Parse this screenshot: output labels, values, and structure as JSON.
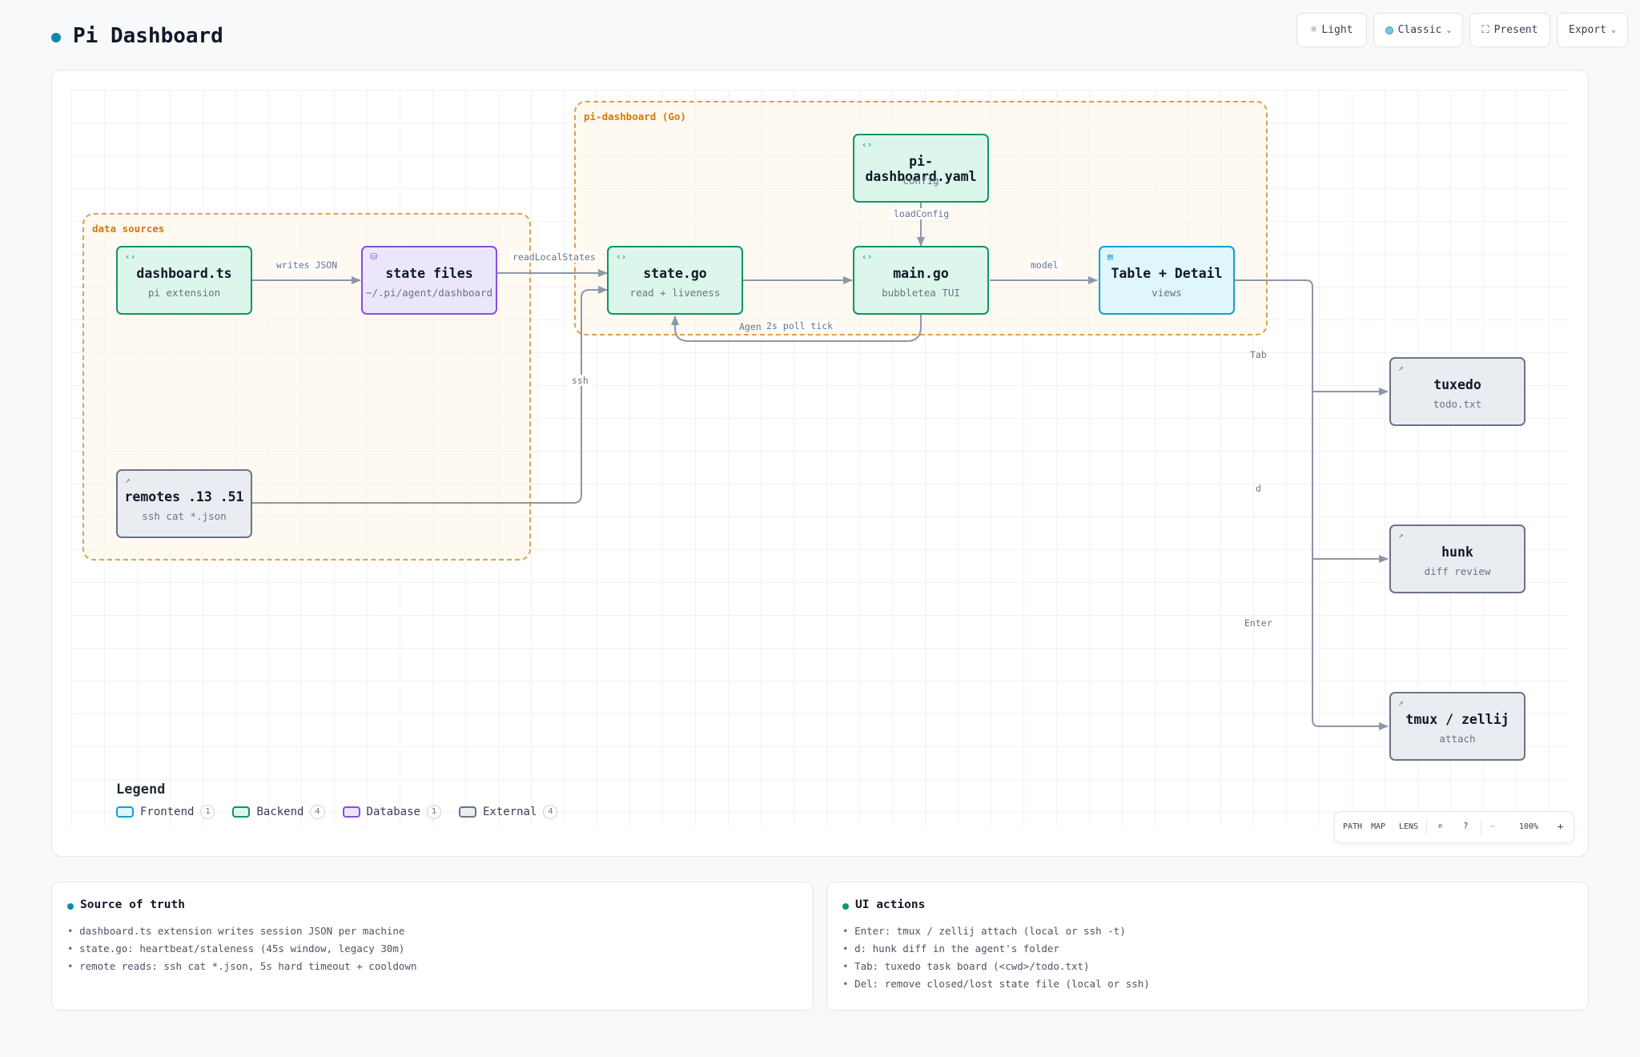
{
  "app": {
    "title": "Pi Dashboard",
    "accent": "#0e8aa8"
  },
  "toolbar": {
    "light": {
      "label": "Light",
      "icon": "sun-icon"
    },
    "classic": {
      "label": "Classic",
      "icon": "theme-dot-icon"
    },
    "present": {
      "label": "Present",
      "icon": "fullscreen-icon"
    },
    "export": {
      "label": "Export",
      "icon": "chevron-down-icon"
    }
  },
  "groups": {
    "data_sources": "data sources",
    "pi_dashboard": "pi-dashboard (Go)"
  },
  "nodes": {
    "dashboard_ts": {
      "title": "dashboard.ts",
      "sub": "pi extension",
      "kind": "Backend"
    },
    "state_files": {
      "title": "state files",
      "sub": "~/.pi/agent/dashboard",
      "kind": "Database"
    },
    "state_go": {
      "title": "state.go",
      "sub": "read + liveness",
      "kind": "Backend"
    },
    "yaml": {
      "title": "pi-dashboard.yaml",
      "sub": "config",
      "kind": "Backend"
    },
    "main_go": {
      "title": "main.go",
      "sub": "bubbletea TUI",
      "kind": "Backend"
    },
    "table": {
      "title": "Table + Detail",
      "sub": "views",
      "kind": "Frontend"
    },
    "remotes": {
      "title": "remotes .13 .51",
      "sub": "ssh cat *.json",
      "kind": "External"
    },
    "tuxedo": {
      "title": "tuxedo",
      "sub": "todo.txt",
      "kind": "External"
    },
    "hunk": {
      "title": "hunk",
      "sub": "diff review",
      "kind": "External"
    },
    "tmux": {
      "title": "tmux / zellij",
      "sub": "attach",
      "kind": "External"
    }
  },
  "edges": {
    "writes_json": "writes JSON",
    "read_local": "readLocalStates",
    "load_config": "loadConfig",
    "model": "model",
    "poll": "2s poll tick",
    "poll_hidden": "Agen",
    "ssh": "ssh",
    "tab": "Tab",
    "d": "d",
    "enter": "Enter"
  },
  "legend": {
    "title": "Legend",
    "items": [
      {
        "label": "Frontend",
        "count": "1",
        "color": "#14a0c8"
      },
      {
        "label": "Backend",
        "count": "4",
        "color": "#12946a"
      },
      {
        "label": "Database",
        "count": "1",
        "color": "#8a4fd8"
      },
      {
        "label": "External",
        "count": "4",
        "color": "#6b7486"
      }
    ]
  },
  "mapbar": {
    "path": "PATH",
    "map": "MAP",
    "lens": "LENS",
    "zoom_out": "−",
    "zoom": "100%",
    "zoom_in": "+"
  },
  "panels": {
    "source": {
      "title": "Source of truth",
      "dot_color": "#0e8aa8",
      "items": [
        "dashboard.ts extension writes session JSON per machine",
        "state.go: heartbeat/staleness (45s window, legacy 30m)",
        "remote reads: ssh cat *.json, 5s hard timeout + cooldown"
      ]
    },
    "ui": {
      "title": "UI actions",
      "dot_color": "#12946a",
      "items": [
        "Enter: tmux / zellij attach (local or ssh -t)",
        "d: hunk diff in the agent's folder",
        "Tab: tuxedo task board (<cwd>/todo.txt)",
        "Del: remove closed/lost state file (local or ssh)"
      ]
    }
  }
}
